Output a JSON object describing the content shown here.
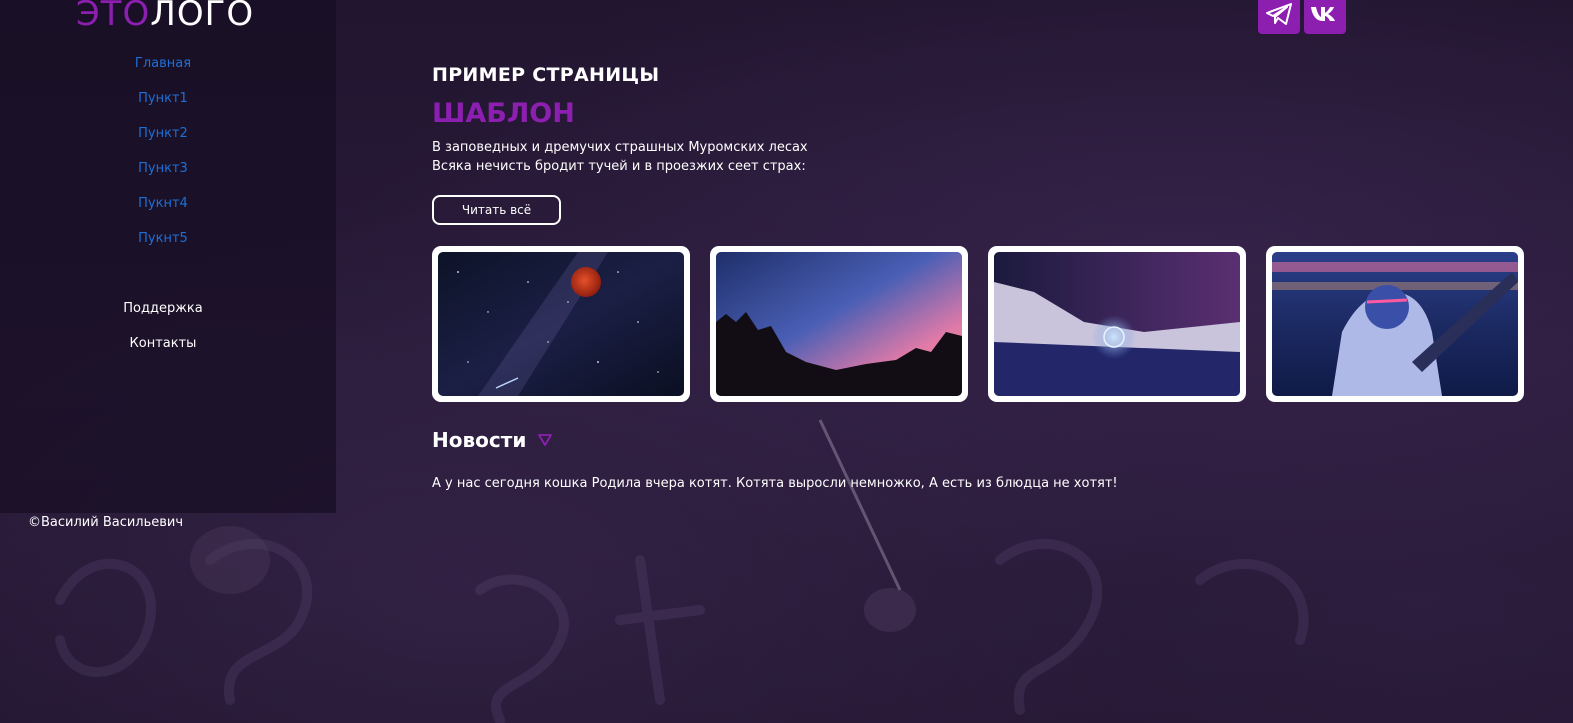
{
  "logo": {
    "accent": "ЭТО",
    "rest": "ЛОГО"
  },
  "nav": {
    "items": [
      {
        "label": "Главная"
      },
      {
        "label": "Пункт1"
      },
      {
        "label": "Пункт2"
      },
      {
        "label": "Пункт3"
      },
      {
        "label": "Пукнт4"
      },
      {
        "label": "Пукнт5"
      }
    ],
    "secondary": [
      {
        "label": "Поддержка"
      },
      {
        "label": "Контакты"
      }
    ]
  },
  "footer": {
    "copyright": "©Василий Васильевич"
  },
  "social": [
    {
      "icon": "telegram-icon"
    },
    {
      "icon": "vk-icon"
    }
  ],
  "main": {
    "title": "ПРИМЕР СТРАНИЦЫ",
    "subtitle": "ШАБЛОН",
    "intro_lines": [
      "В заповедных и дремучих страшных Муромских лесах",
      "Всяка нечисть бродит тучей и в проезжих сеет страх:"
    ],
    "read_more": "Читать всё",
    "gallery": [
      {
        "icon": "night-sky-red-moon-image"
      },
      {
        "icon": "sunset-rocks-image"
      },
      {
        "icon": "snowy-mountain-light-painting-image"
      },
      {
        "icon": "neon-portrait-image"
      }
    ],
    "news": {
      "title": "Новости",
      "text": "А у нас сегодня кошка Родила вчера котят. Котята выросли немножко, А есть из блюдца не хотят!"
    }
  },
  "colors": {
    "accent": "#8c1fb0",
    "nav_link": "#1f6fd6",
    "background": "#261a35",
    "sidebar": "#160e22"
  }
}
